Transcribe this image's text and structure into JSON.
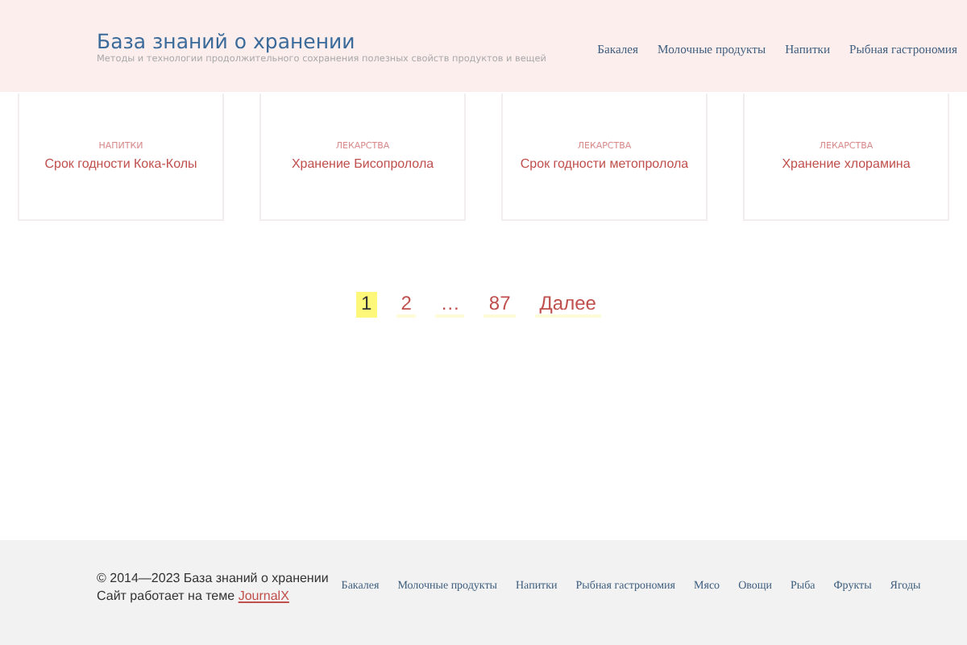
{
  "header": {
    "site_title": "База знаний о хранении",
    "tagline": "Методы и технологии продолжительного сохранения полезных свойств продуктов и вещей",
    "menu": [
      "Бакалея",
      "Молочные продукты",
      "Напитки",
      "Рыбная гастрономия"
    ]
  },
  "cards": [
    {
      "category": "НАПИТКИ",
      "title": "Срок годности Кока-Колы"
    },
    {
      "category": "ЛЕКАРСТВА",
      "title": "Хранение Бисопролола"
    },
    {
      "category": "ЛЕКАРСТВА",
      "title": "Срок годности метопролола"
    },
    {
      "category": "ЛЕКАРСТВА",
      "title": "Хранение хлорамина"
    }
  ],
  "pagination": [
    {
      "label": "1",
      "selected": true
    },
    {
      "label": "2",
      "selected": false
    },
    {
      "label": "…",
      "selected": false
    },
    {
      "label": "87",
      "selected": false
    },
    {
      "label": "Далее",
      "selected": false
    }
  ],
  "footer": {
    "copyright": "© 2014—2023 База знаний о хранении",
    "theme_text": "Сайт работает на теме",
    "theme_link": "JournalX",
    "menu": [
      "Бакалея",
      "Молочные продукты",
      "Напитки",
      "Рыбная гастрономия",
      "Мясо",
      "Овощи",
      "Рыба",
      "Фрукты",
      "Ягоды"
    ]
  }
}
